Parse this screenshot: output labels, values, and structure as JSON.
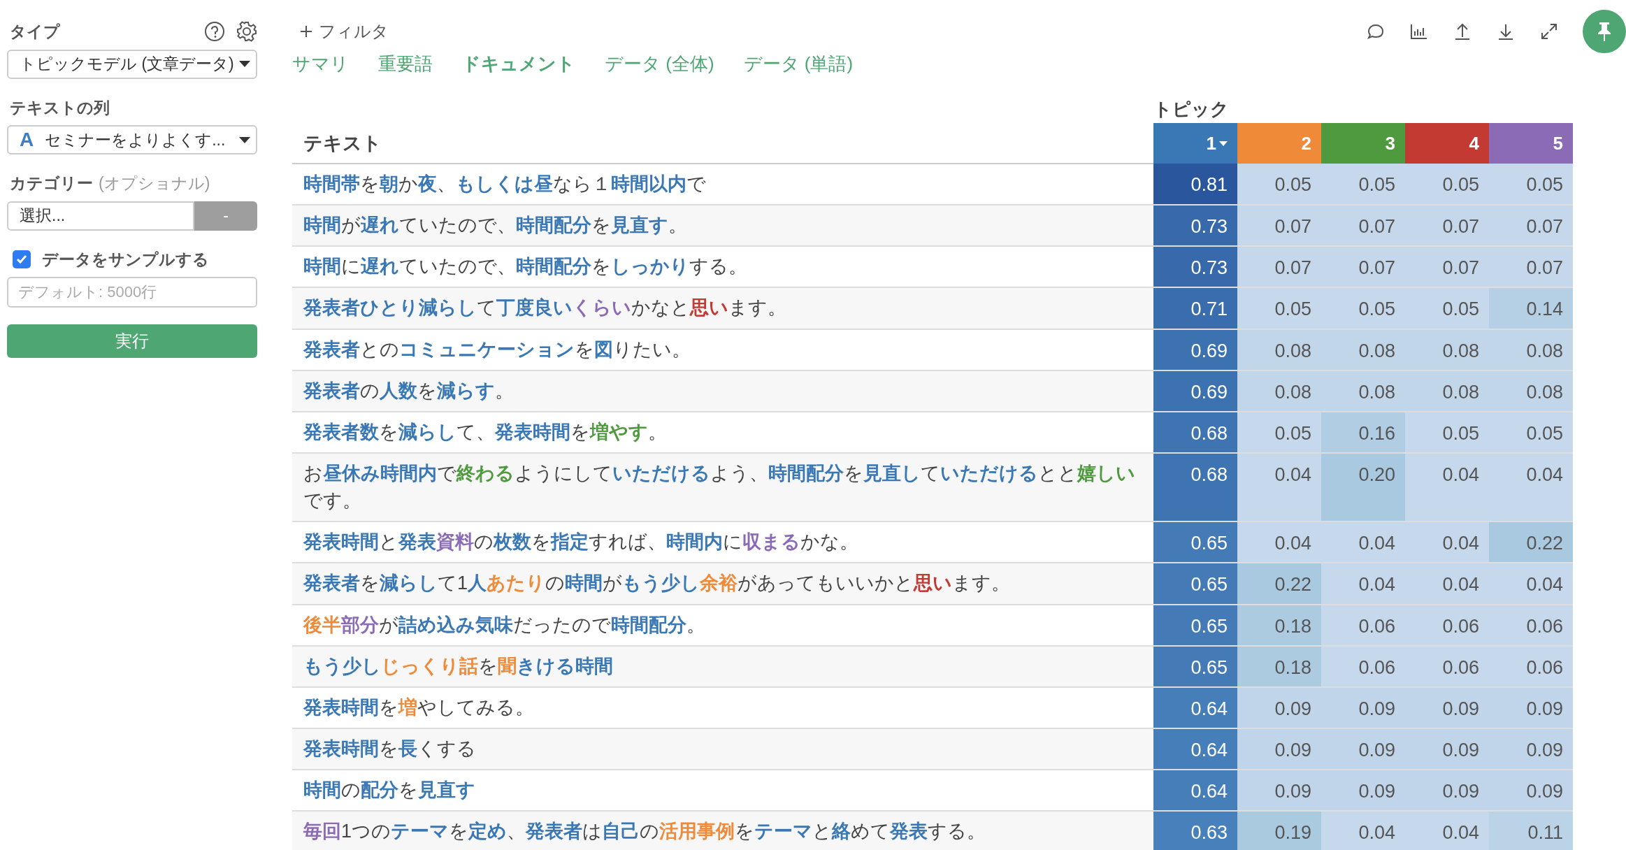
{
  "sidebar": {
    "type_label": "タイプ",
    "type_value": "トピックモデル (文章データ)",
    "text_column_label": "テキストの列",
    "column_type_icon": "A",
    "text_column_value": "セミナーをよりよくす...",
    "category_label": "カテゴリー",
    "category_optional": "(オプショナル)",
    "category_value": "選択...",
    "category_button": "-",
    "sample": {
      "label": "データをサンプルする",
      "checked": true
    },
    "sample_size_placeholder": "デフォルト: 5000行",
    "run_button": "実行"
  },
  "toolbar": {
    "filter": "フィルタ"
  },
  "tabs": [
    {
      "label": "サマリ",
      "selected": false
    },
    {
      "label": "重要語",
      "selected": false
    },
    {
      "label": "ドキュメント",
      "selected": true
    },
    {
      "label": "データ (全体)",
      "selected": false
    },
    {
      "label": "データ (単語)",
      "selected": false
    }
  ],
  "table": {
    "group_header": "トピック",
    "text_header": "テキスト",
    "topics": [
      {
        "label": "1",
        "color": "#3a78b5",
        "sorted": true
      },
      {
        "label": "2",
        "color": "#ee8a38",
        "sorted": false
      },
      {
        "label": "3",
        "color": "#4f9a3f",
        "sorted": false
      },
      {
        "label": "4",
        "color": "#c33a32",
        "sorted": false
      },
      {
        "label": "5",
        "color": "#8b6bb5",
        "sorted": false
      }
    ],
    "rows": [
      {
        "segments": [
          {
            "text": "時間帯",
            "color": "#3a78b5"
          },
          {
            "text": "を"
          },
          {
            "text": "朝",
            "color": "#3a78b5"
          },
          {
            "text": "か"
          },
          {
            "text": "夜",
            "color": "#3a78b5"
          },
          {
            "text": "、"
          },
          {
            "text": "もしくは昼",
            "color": "#3a78b5"
          },
          {
            "text": "なら１"
          },
          {
            "text": "時間以内",
            "color": "#3a78b5"
          },
          {
            "text": "で"
          }
        ],
        "values": [
          "0.81",
          "0.05",
          "0.05",
          "0.05",
          "0.05"
        ]
      },
      {
        "segments": [
          {
            "text": "時間",
            "color": "#3a78b5"
          },
          {
            "text": "が"
          },
          {
            "text": "遅れ",
            "color": "#3a78b5"
          },
          {
            "text": "ていたので、"
          },
          {
            "text": "時間配分",
            "color": "#3a78b5"
          },
          {
            "text": "を"
          },
          {
            "text": "見直す",
            "color": "#3a78b5"
          },
          {
            "text": "。"
          }
        ],
        "values": [
          "0.73",
          "0.07",
          "0.07",
          "0.07",
          "0.07"
        ]
      },
      {
        "segments": [
          {
            "text": "時間",
            "color": "#3a78b5"
          },
          {
            "text": "に"
          },
          {
            "text": "遅れ",
            "color": "#3a78b5"
          },
          {
            "text": "ていたので、"
          },
          {
            "text": "時間配分",
            "color": "#3a78b5"
          },
          {
            "text": "を"
          },
          {
            "text": "しっかり",
            "color": "#3a78b5"
          },
          {
            "text": "する。"
          }
        ],
        "values": [
          "0.73",
          "0.07",
          "0.07",
          "0.07",
          "0.07"
        ]
      },
      {
        "segments": [
          {
            "text": "発表者ひとり減らし",
            "color": "#3a78b5"
          },
          {
            "text": "て"
          },
          {
            "text": "丁度良い",
            "color": "#3a78b5"
          },
          {
            "text": "くらい",
            "color": "#8b6bb5"
          },
          {
            "text": "かなと"
          },
          {
            "text": "思い",
            "color": "#c33a32"
          },
          {
            "text": "ます。"
          }
        ],
        "values": [
          "0.71",
          "0.05",
          "0.05",
          "0.05",
          "0.14"
        ]
      },
      {
        "segments": [
          {
            "text": "発表者",
            "color": "#3a78b5"
          },
          {
            "text": "との"
          },
          {
            "text": "コミュニケーション",
            "color": "#3a78b5"
          },
          {
            "text": "を"
          },
          {
            "text": "図",
            "color": "#3a78b5"
          },
          {
            "text": "りたい。"
          }
        ],
        "values": [
          "0.69",
          "0.08",
          "0.08",
          "0.08",
          "0.08"
        ]
      },
      {
        "segments": [
          {
            "text": "発表者",
            "color": "#3a78b5"
          },
          {
            "text": "の"
          },
          {
            "text": "人数",
            "color": "#3a78b5"
          },
          {
            "text": "を"
          },
          {
            "text": "減らす",
            "color": "#3a78b5"
          },
          {
            "text": "。"
          }
        ],
        "values": [
          "0.69",
          "0.08",
          "0.08",
          "0.08",
          "0.08"
        ]
      },
      {
        "segments": [
          {
            "text": "発表者数",
            "color": "#3a78b5"
          },
          {
            "text": "を"
          },
          {
            "text": "減らし",
            "color": "#3a78b5"
          },
          {
            "text": "て、"
          },
          {
            "text": "発表時間",
            "color": "#3a78b5"
          },
          {
            "text": "を"
          },
          {
            "text": "増やす",
            "color": "#4f9a3f"
          },
          {
            "text": "。"
          }
        ],
        "values": [
          "0.68",
          "0.05",
          "0.16",
          "0.05",
          "0.05"
        ]
      },
      {
        "segments": [
          {
            "text": "お"
          },
          {
            "text": "昼休み時間内",
            "color": "#3a78b5"
          },
          {
            "text": "で"
          },
          {
            "text": "終わる",
            "color": "#4f9a3f"
          },
          {
            "text": "ようにして"
          },
          {
            "text": "いただける",
            "color": "#3a78b5"
          },
          {
            "text": "よう、"
          },
          {
            "text": "時間配分",
            "color": "#3a78b5"
          },
          {
            "text": "を"
          },
          {
            "text": "見直し",
            "color": "#3a78b5"
          },
          {
            "text": "て"
          },
          {
            "text": "いただける",
            "color": "#3a78b5"
          },
          {
            "text": "とと"
          },
          {
            "text": "嬉しい",
            "color": "#4f9a3f"
          },
          {
            "text": "です。"
          }
        ],
        "values": [
          "0.68",
          "0.04",
          "0.20",
          "0.04",
          "0.04"
        ]
      },
      {
        "segments": [
          {
            "text": "発表時間",
            "color": "#3a78b5"
          },
          {
            "text": "と"
          },
          {
            "text": "発表",
            "color": "#3a78b5"
          },
          {
            "text": "資料",
            "color": "#8b6bb5"
          },
          {
            "text": "の"
          },
          {
            "text": "枚数",
            "color": "#3a78b5"
          },
          {
            "text": "を"
          },
          {
            "text": "指定",
            "color": "#3a78b5"
          },
          {
            "text": "すれば、"
          },
          {
            "text": "時間内",
            "color": "#3a78b5"
          },
          {
            "text": "に"
          },
          {
            "text": "収まる",
            "color": "#8b6bb5"
          },
          {
            "text": "かな。"
          }
        ],
        "values": [
          "0.65",
          "0.04",
          "0.04",
          "0.04",
          "0.22"
        ]
      },
      {
        "segments": [
          {
            "text": "発表者",
            "color": "#3a78b5"
          },
          {
            "text": "を"
          },
          {
            "text": "減らし",
            "color": "#3a78b5"
          },
          {
            "text": "て1"
          },
          {
            "text": "人",
            "color": "#3a78b5"
          },
          {
            "text": "あたり",
            "color": "#ee8a38"
          },
          {
            "text": "の"
          },
          {
            "text": "時間",
            "color": "#3a78b5"
          },
          {
            "text": "が"
          },
          {
            "text": "もう少し",
            "color": "#3a78b5"
          },
          {
            "text": "余裕",
            "color": "#ee8a38"
          },
          {
            "text": "があってもいいかと"
          },
          {
            "text": "思い",
            "color": "#c33a32"
          },
          {
            "text": "ます。"
          }
        ],
        "values": [
          "0.65",
          "0.22",
          "0.04",
          "0.04",
          "0.04"
        ]
      },
      {
        "segments": [
          {
            "text": "後半",
            "color": "#ee8a38"
          },
          {
            "text": "部分",
            "color": "#8b6bb5"
          },
          {
            "text": "が"
          },
          {
            "text": "詰め込み気味",
            "color": "#3a78b5"
          },
          {
            "text": "だったので"
          },
          {
            "text": "時間配分",
            "color": "#3a78b5"
          },
          {
            "text": "。"
          }
        ],
        "values": [
          "0.65",
          "0.18",
          "0.06",
          "0.06",
          "0.06"
        ]
      },
      {
        "segments": [
          {
            "text": "もう少し",
            "color": "#3a78b5"
          },
          {
            "text": "じっくり話",
            "color": "#ee8a38"
          },
          {
            "text": "を"
          },
          {
            "text": "聞",
            "color": "#ee8a38"
          },
          {
            "text": "きける時間",
            "color": "#3a78b5"
          }
        ],
        "values": [
          "0.65",
          "0.18",
          "0.06",
          "0.06",
          "0.06"
        ]
      },
      {
        "segments": [
          {
            "text": "発表時間",
            "color": "#3a78b5"
          },
          {
            "text": "を"
          },
          {
            "text": "増",
            "color": "#ee8a38"
          },
          {
            "text": "やしてみる。"
          }
        ],
        "values": [
          "0.64",
          "0.09",
          "0.09",
          "0.09",
          "0.09"
        ]
      },
      {
        "segments": [
          {
            "text": "発表時間",
            "color": "#3a78b5"
          },
          {
            "text": "を"
          },
          {
            "text": "長",
            "color": "#3a78b5"
          },
          {
            "text": "くする"
          }
        ],
        "values": [
          "0.64",
          "0.09",
          "0.09",
          "0.09",
          "0.09"
        ]
      },
      {
        "segments": [
          {
            "text": "時間",
            "color": "#3a78b5"
          },
          {
            "text": "の"
          },
          {
            "text": "配分",
            "color": "#3a78b5"
          },
          {
            "text": "を"
          },
          {
            "text": "見直す",
            "color": "#3a78b5"
          }
        ],
        "values": [
          "0.64",
          "0.09",
          "0.09",
          "0.09",
          "0.09"
        ]
      },
      {
        "segments": [
          {
            "text": "毎回",
            "color": "#8b6bb5"
          },
          {
            "text": "1つの"
          },
          {
            "text": "テーマ",
            "color": "#3a78b5"
          },
          {
            "text": "を"
          },
          {
            "text": "定め",
            "color": "#3a78b5"
          },
          {
            "text": "、"
          },
          {
            "text": "発表者",
            "color": "#3a78b5"
          },
          {
            "text": "は"
          },
          {
            "text": "自己",
            "color": "#3a78b5"
          },
          {
            "text": "の"
          },
          {
            "text": "活用事例",
            "color": "#ee8a38"
          },
          {
            "text": "を"
          },
          {
            "text": "テーマ",
            "color": "#3a78b5"
          },
          {
            "text": "と"
          },
          {
            "text": "絡",
            "color": "#3a78b5"
          },
          {
            "text": "めて"
          },
          {
            "text": "発表",
            "color": "#3a78b5"
          },
          {
            "text": "する。"
          }
        ],
        "values": [
          "0.63",
          "0.19",
          "0.04",
          "0.04",
          "0.11"
        ]
      }
    ]
  }
}
